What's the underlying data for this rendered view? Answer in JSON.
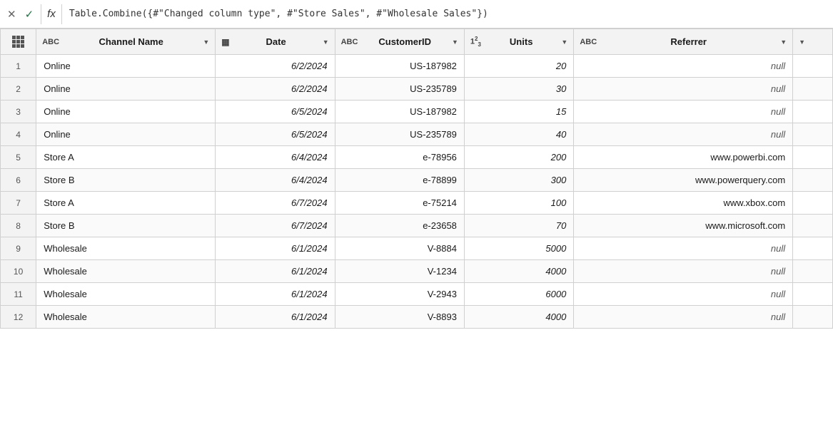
{
  "formula_bar": {
    "cancel_label": "✕",
    "confirm_label": "✓",
    "fx_label": "fx",
    "formula": "Table.Combine({#\"Changed column type\", #\"Store Sales\", #\"Wholesale Sales\"})"
  },
  "table": {
    "columns": [
      {
        "id": "channel",
        "label": "Channel Name",
        "type": "ABC",
        "type_icon": "ABC",
        "class": "col-channel"
      },
      {
        "id": "date",
        "label": "Date",
        "type": "grid",
        "type_icon": "DATE",
        "class": "col-date"
      },
      {
        "id": "customer",
        "label": "CustomerID",
        "type": "ABC",
        "type_icon": "ABC",
        "class": "col-customer"
      },
      {
        "id": "units",
        "label": "Units",
        "type": "123",
        "type_icon": "123",
        "class": "col-units"
      },
      {
        "id": "referrer",
        "label": "Referrer",
        "type": "ABC",
        "type_icon": "ABC",
        "class": "col-referrer"
      }
    ],
    "rows": [
      {
        "num": 1,
        "channel": "Online",
        "date": "6/2/2024",
        "customer": "US-187982",
        "units": "20",
        "referrer": null
      },
      {
        "num": 2,
        "channel": "Online",
        "date": "6/2/2024",
        "customer": "US-235789",
        "units": "30",
        "referrer": null
      },
      {
        "num": 3,
        "channel": "Online",
        "date": "6/5/2024",
        "customer": "US-187982",
        "units": "15",
        "referrer": null
      },
      {
        "num": 4,
        "channel": "Online",
        "date": "6/5/2024",
        "customer": "US-235789",
        "units": "40",
        "referrer": null
      },
      {
        "num": 5,
        "channel": "Store A",
        "date": "6/4/2024",
        "customer": "e-78956",
        "units": "200",
        "referrer": "www.powerbi.com"
      },
      {
        "num": 6,
        "channel": "Store B",
        "date": "6/4/2024",
        "customer": "e-78899",
        "units": "300",
        "referrer": "www.powerquery.com"
      },
      {
        "num": 7,
        "channel": "Store A",
        "date": "6/7/2024",
        "customer": "e-75214",
        "units": "100",
        "referrer": "www.xbox.com"
      },
      {
        "num": 8,
        "channel": "Store B",
        "date": "6/7/2024",
        "customer": "e-23658",
        "units": "70",
        "referrer": "www.microsoft.com"
      },
      {
        "num": 9,
        "channel": "Wholesale",
        "date": "6/1/2024",
        "customer": "V-8884",
        "units": "5000",
        "referrer": null
      },
      {
        "num": 10,
        "channel": "Wholesale",
        "date": "6/1/2024",
        "customer": "V-1234",
        "units": "4000",
        "referrer": null
      },
      {
        "num": 11,
        "channel": "Wholesale",
        "date": "6/1/2024",
        "customer": "V-2943",
        "units": "6000",
        "referrer": null
      },
      {
        "num": 12,
        "channel": "Wholesale",
        "date": "6/1/2024",
        "customer": "V-8893",
        "units": "4000",
        "referrer": null
      }
    ]
  }
}
